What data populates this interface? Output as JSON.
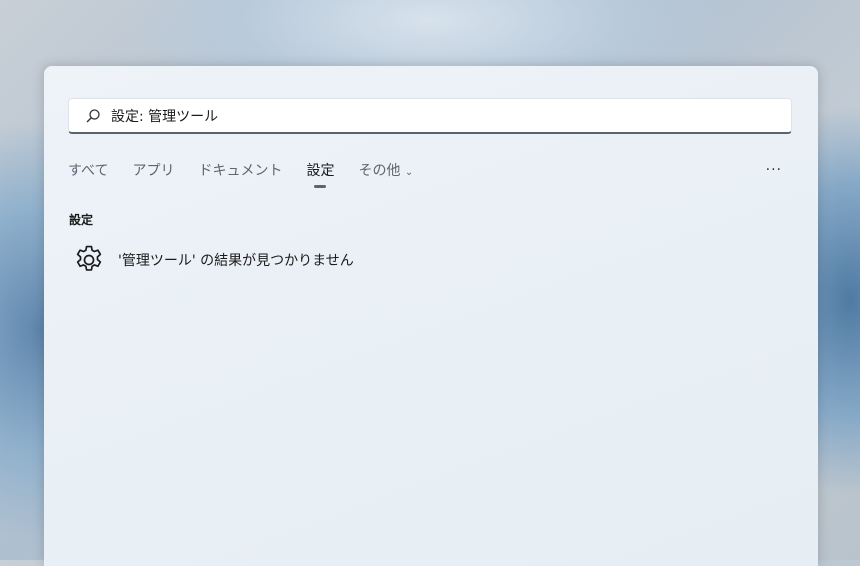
{
  "search": {
    "value": "設定: 管理ツール",
    "icon": "search-icon"
  },
  "tabs": [
    {
      "label": "すべて"
    },
    {
      "label": "アプリ"
    },
    {
      "label": "ドキュメント"
    },
    {
      "label": "設定",
      "active": true
    },
    {
      "label": "その他"
    }
  ],
  "more_label": "···",
  "section_title": "設定",
  "result": {
    "text": "'管理ツール' の結果が見つかりません",
    "icon": "gear-icon"
  }
}
